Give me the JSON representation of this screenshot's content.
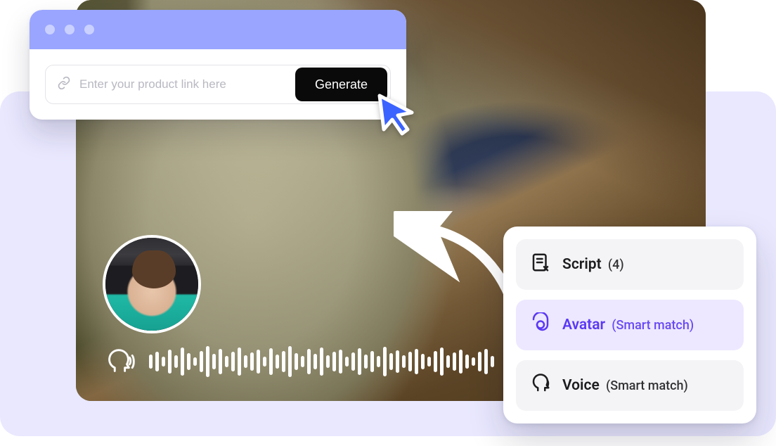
{
  "input": {
    "placeholder": "Enter your product link here",
    "button_label": "Generate"
  },
  "options": [
    {
      "id": "script",
      "icon": "script-icon",
      "label": "Script",
      "sub": "(4)",
      "active": false
    },
    {
      "id": "avatar",
      "icon": "avatar-icon",
      "label": "Avatar",
      "sub": "(Smart match)",
      "active": true
    },
    {
      "id": "voice",
      "icon": "voice-icon",
      "label": "Voice",
      "sub": "(Smart match)",
      "active": false
    }
  ],
  "colors": {
    "accent": "#5b38f5",
    "cursor": "#3b63ff",
    "titlebar": "#99a5ff",
    "bgpanel": "#e9e8ff"
  },
  "waveform_heights": [
    20,
    28,
    14,
    34,
    18,
    40,
    24,
    12,
    30,
    44,
    22,
    36,
    16,
    28,
    40,
    18,
    26,
    34,
    14,
    38,
    20,
    30,
    44,
    24,
    16,
    36,
    22,
    40,
    18,
    28,
    34,
    14,
    26,
    38,
    20,
    30,
    16,
    42,
    24,
    32,
    18,
    28,
    36,
    22,
    14,
    30,
    40,
    18,
    26,
    34,
    20,
    12,
    28,
    36,
    16
  ]
}
